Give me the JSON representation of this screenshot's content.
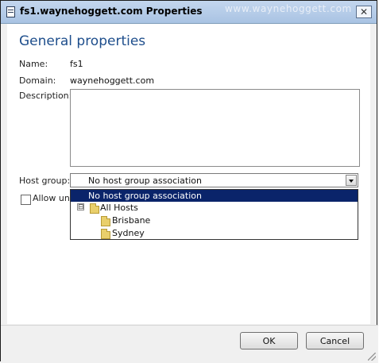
{
  "window": {
    "title": "fs1.waynehoggett.com Properties",
    "watermark": "www.waynehoggett.com",
    "close_icon": "close-icon",
    "app_icon": "server-properties-icon"
  },
  "form": {
    "heading": "General properties",
    "name_label": "Name:",
    "name_value": "fs1",
    "domain_label": "Domain:",
    "domain_value": "waynehoggett.com",
    "description_label": "Description:",
    "description_value": "",
    "host_group_label": "Host group:",
    "host_group_value": "No host group association",
    "allow_checkbox_label": "Allow une",
    "allow_checked": false
  },
  "dropdown": {
    "open": true,
    "selected": "No host group association",
    "items": [
      {
        "label": "No host group association",
        "selected": true,
        "icon": ""
      },
      {
        "label": "All Hosts",
        "selected": false,
        "icon": "folder-icon",
        "expander": "⊟"
      },
      {
        "label": "Brisbane",
        "selected": false,
        "icon": "folder-icon"
      },
      {
        "label": "Sydney",
        "selected": false,
        "icon": "folder-icon"
      }
    ]
  },
  "buttons": {
    "ok": "OK",
    "cancel": "Cancel"
  },
  "colors": {
    "heading": "#1e4e8c",
    "selection": "#0a246a"
  }
}
